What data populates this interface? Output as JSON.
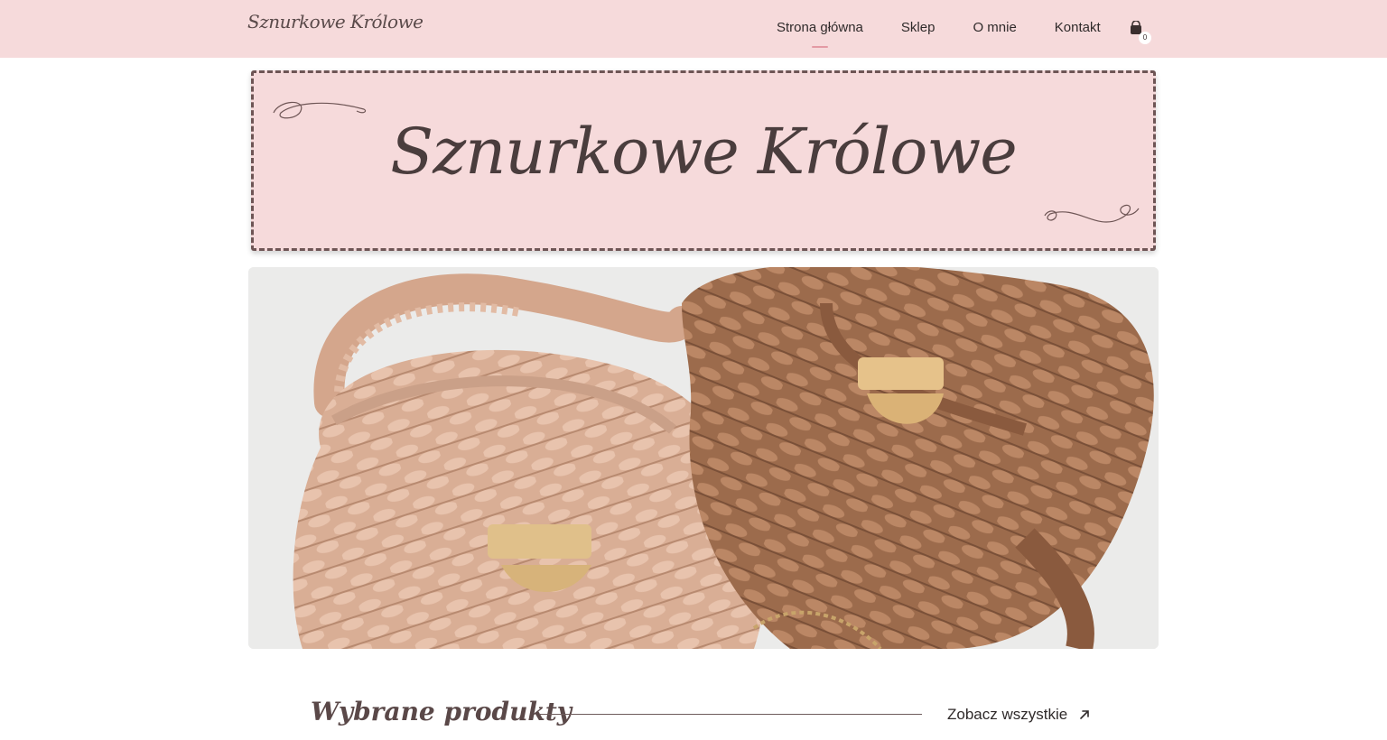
{
  "header": {
    "logo_text": "Sznurkowe Królowe",
    "nav": [
      {
        "label": "Strona główna",
        "active": true
      },
      {
        "label": "Sklep",
        "active": false
      },
      {
        "label": "O mnie",
        "active": false
      },
      {
        "label": "Kontakt",
        "active": false
      }
    ],
    "cart": {
      "icon": "shopping-bag-icon",
      "count": "0"
    }
  },
  "banner": {
    "title": "Sznurkowe Królowe",
    "decor": "flourish"
  },
  "hero": {
    "image": "crochet-bags-photo"
  },
  "products_section": {
    "title": "Wybrane produkty",
    "see_all_label": "Zobacz wszystkie",
    "see_all_icon": "arrow-up-right-icon"
  },
  "colors": {
    "header_bg": "#f6dadb",
    "banner_border": "#6e5555",
    "accent": "#e39aa4",
    "text": "#2f2a2a"
  }
}
